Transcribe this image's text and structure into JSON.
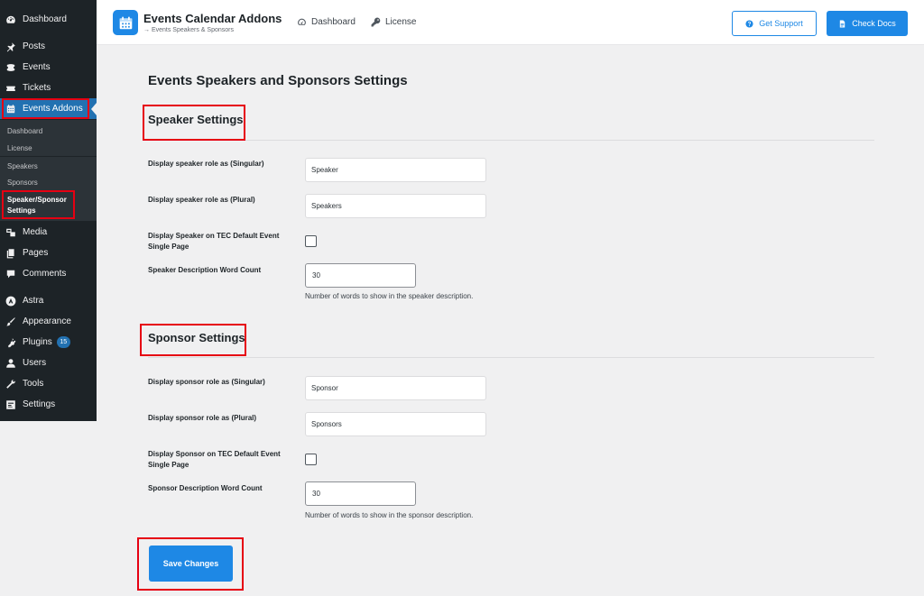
{
  "sidebar": {
    "items": [
      {
        "label": "Dashboard",
        "icon": "dashboard-icon"
      },
      {
        "label": "Posts",
        "icon": "pin-icon"
      },
      {
        "label": "Events",
        "icon": "events-icon"
      },
      {
        "label": "Tickets",
        "icon": "ticket-icon"
      },
      {
        "label": "Events Addons",
        "icon": "calendar-icon"
      },
      {
        "label": "Media",
        "icon": "media-icon"
      },
      {
        "label": "Pages",
        "icon": "pages-icon"
      },
      {
        "label": "Comments",
        "icon": "comments-icon"
      },
      {
        "label": "Astra",
        "icon": "astra-icon"
      },
      {
        "label": "Appearance",
        "icon": "brush-icon"
      },
      {
        "label": "Plugins",
        "icon": "plugin-icon",
        "badge": "15"
      },
      {
        "label": "Users",
        "icon": "users-icon"
      },
      {
        "label": "Tools",
        "icon": "wrench-icon"
      },
      {
        "label": "Settings",
        "icon": "settings-icon"
      }
    ],
    "submenu": [
      {
        "label": "Dashboard"
      },
      {
        "label": "License"
      },
      {
        "label": "Speakers"
      },
      {
        "label": "Sponsors"
      },
      {
        "label": "Speaker/Sponsor Settings"
      }
    ]
  },
  "header": {
    "title": "Events Calendar Addons",
    "subtitle": "→ Events Speakers & Sponsors",
    "nav": [
      {
        "label": "Dashboard",
        "icon": "gauge-icon"
      },
      {
        "label": "License",
        "icon": "key-icon"
      }
    ],
    "support_label": "Get Support",
    "docs_label": "Check Docs"
  },
  "page": {
    "title": "Events Speakers and Sponsors Settings",
    "speaker": {
      "section_title": "Speaker Settings",
      "singular_label": "Display speaker role as (Singular)",
      "singular_value": "Speaker",
      "plural_label": "Display speaker role as (Plural)",
      "plural_value": "Speakers",
      "display_label": "Display Speaker on TEC Default Event Single Page",
      "display_checked": false,
      "word_count_label": "Speaker Description Word Count",
      "word_count_value": "30",
      "word_count_desc": "Number of words to show in the speaker description."
    },
    "sponsor": {
      "section_title": "Sponsor Settings",
      "singular_label": "Display sponsor role as (Singular)",
      "singular_value": "Sponsor",
      "plural_label": "Display sponsor role as (Plural)",
      "plural_value": "Sponsors",
      "display_label": "Display Sponsor on TEC Default Event Single Page",
      "display_checked": false,
      "word_count_label": "Sponsor Description Word Count",
      "word_count_value": "30",
      "word_count_desc": "Number of words to show in the sponsor description."
    },
    "save_label": "Save Changes"
  },
  "colors": {
    "sidebar_bg": "#1d2327",
    "active": "#2271b1",
    "brand_blue": "#1e88e5",
    "highlight_red": "#e60012"
  }
}
